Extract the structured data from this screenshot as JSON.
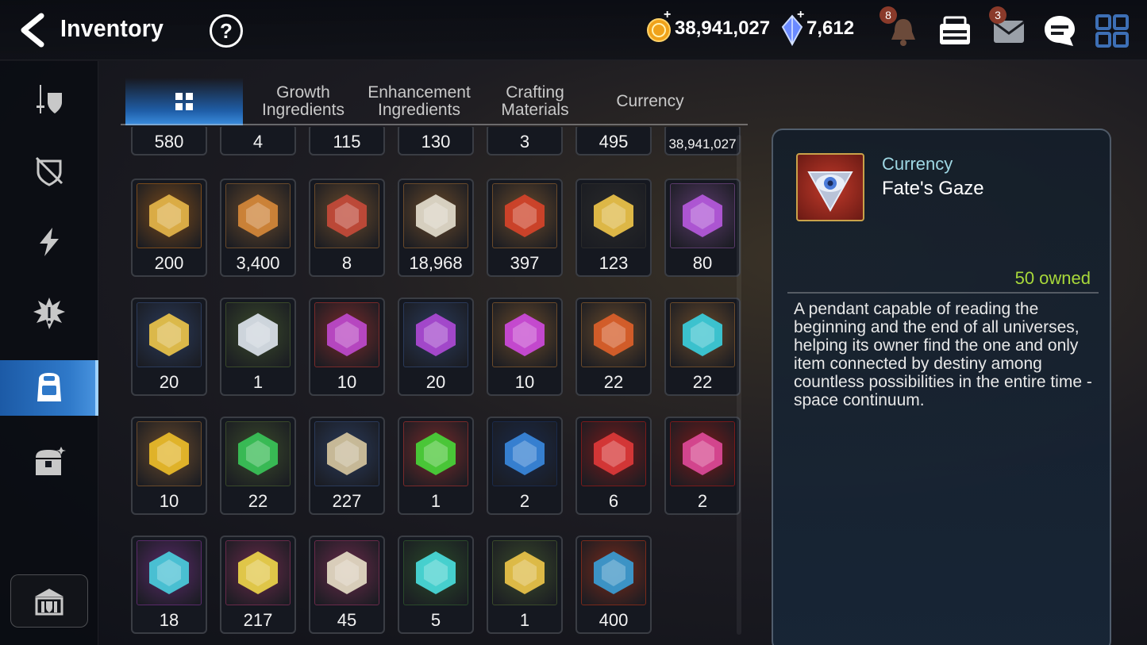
{
  "header": {
    "title": "Inventory",
    "help_label": "?",
    "gold": "38,941,027",
    "crystals": "7,612",
    "notifications_badge": "8",
    "mail_badge": "3"
  },
  "sidebar": {
    "items": [
      {
        "icon": "sword-shield-icon"
      },
      {
        "icon": "broken-shield-icon"
      },
      {
        "icon": "lightning-icon"
      },
      {
        "icon": "spiky-gear-icon"
      },
      {
        "icon": "backpack-icon"
      },
      {
        "icon": "treasure-chest-icon"
      }
    ],
    "active_index": 4,
    "bottom_icon": "guild-hall-icon"
  },
  "tabs": [
    {
      "label": "",
      "icon": "grid-icon",
      "active": true
    },
    {
      "label": "Growth Ingredients"
    },
    {
      "label": "Enhancement Ingredients"
    },
    {
      "label": "Crafting Materials"
    },
    {
      "label": "Currency"
    }
  ],
  "grid": {
    "partial_row": [
      "580",
      "4",
      "115",
      "130",
      "3",
      "495",
      "38,941,027"
    ],
    "rows": [
      [
        {
          "qty": "200",
          "icon": "gold-shield-emblem-icon",
          "frame": "#7a4a1a"
        },
        {
          "qty": "3,400",
          "icon": "crossed-axes-emblem-icon",
          "frame": "#6a4a2a"
        },
        {
          "qty": "8",
          "icon": "war-banner-icon",
          "frame": "#6a4a2a"
        },
        {
          "qty": "18,968",
          "icon": "chess-knight-icon",
          "frame": "#6a4a2a"
        },
        {
          "qty": "397",
          "icon": "red-leaf-icon",
          "frame": "#6a4a2a"
        },
        {
          "qty": "123",
          "icon": "golden-mascot-icon",
          "frame": "#2a2a2a"
        },
        {
          "qty": "80",
          "icon": "purple-flower-icon",
          "frame": "#5a3a6a"
        }
      ],
      [
        {
          "qty": "20",
          "icon": "gold-lotus-icon",
          "frame": "#2a3a5a"
        },
        {
          "qty": "1",
          "icon": "silver-lotus-icon",
          "frame": "#3a4a2a"
        },
        {
          "qty": "10",
          "icon": "purple-pentagon-gem-icon",
          "frame": "#7a2a2a"
        },
        {
          "qty": "20",
          "icon": "purple-triangle-gem-icon",
          "frame": "#2a3a5a"
        },
        {
          "qty": "10",
          "icon": "purple-oval-gem-icon",
          "frame": "#6a4a2a"
        },
        {
          "qty": "22",
          "icon": "red-oval-gem-icon",
          "frame": "#6a4a2a"
        },
        {
          "qty": "22",
          "icon": "cyan-oval-gem-icon",
          "frame": "#6a4a2a"
        }
      ],
      [
        {
          "qty": "10",
          "icon": "yellow-oval-gem-icon",
          "frame": "#6a4a2a"
        },
        {
          "qty": "22",
          "icon": "green-oval-gem-icon",
          "frame": "#3a4a2a"
        },
        {
          "qty": "227",
          "icon": "herb-root-icon",
          "frame": "#2a3a5a"
        },
        {
          "qty": "1",
          "icon": "green-orb-icon",
          "frame": "#7a2a2a"
        },
        {
          "qty": "2",
          "icon": "blue-rune-circle-icon",
          "frame": "#1a2a4a"
        },
        {
          "qty": "6",
          "icon": "red-hex-crystal-icon",
          "frame": "#7a1a1a"
        },
        {
          "qty": "2",
          "icon": "pink-potion-icon",
          "frame": "#7a1a1a"
        }
      ],
      [
        {
          "qty": "18",
          "icon": "purple-hex-star-stone-icon",
          "frame": "#5a2a6a"
        },
        {
          "qty": "217",
          "icon": "pink-hammer-stone-icon",
          "frame": "#6a2a4a"
        },
        {
          "qty": "45",
          "icon": "pink-bolt-stone-icon",
          "frame": "#6a2a4a"
        },
        {
          "qty": "5",
          "icon": "green-hex-star-stone-icon",
          "frame": "#2a4a2a"
        },
        {
          "qty": "1",
          "icon": "green-hammer-stone-icon",
          "frame": "#3a4a2a"
        },
        {
          "qty": "400",
          "icon": "dark-crystal-shard-icon",
          "frame": "#7a2a1a"
        }
      ]
    ]
  },
  "detail": {
    "category": "Currency",
    "name": "Fate's Gaze",
    "owned": "50 owned",
    "description": "A pendant capable of reading the beginning and the end of all universes, helping its owner find the one and only item connected by destiny among countless possibilities in the entire time -space continuum.",
    "icon": "eye-pendant-icon"
  },
  "colors": {
    "accent": "#2f79c9",
    "owned": "#a8d83a",
    "category": "#9fd8e4"
  }
}
